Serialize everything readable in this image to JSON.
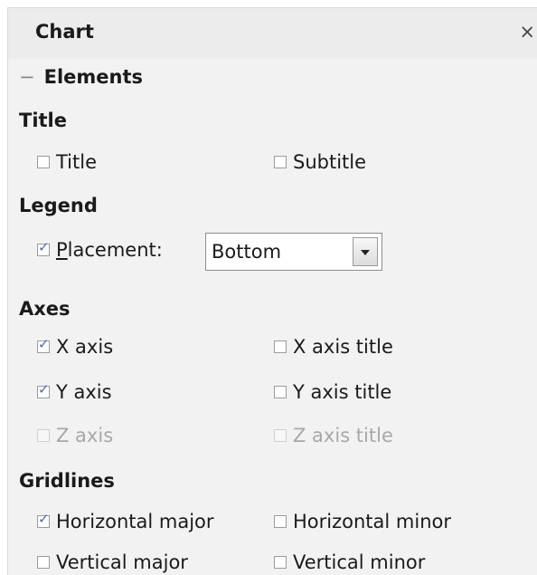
{
  "panel": {
    "title": "Chart",
    "close_glyph": "×"
  },
  "section": {
    "toggle_glyph": "−",
    "label": "Elements"
  },
  "title_group": {
    "heading": "Title",
    "title": {
      "label": "Title",
      "checked": false
    },
    "subtitle": {
      "label": "Subtitle",
      "checked": false
    }
  },
  "legend_group": {
    "heading": "Legend",
    "placement": {
      "label_first": "P",
      "label_rest": "lacement:",
      "checked": true
    },
    "placement_select": {
      "value": "Bottom"
    }
  },
  "axes_group": {
    "heading": "Axes",
    "x_axis": {
      "label": "X axis",
      "checked": true,
      "enabled": true
    },
    "x_axis_title": {
      "label": "X axis title",
      "checked": false,
      "enabled": true
    },
    "y_axis": {
      "label": "Y axis",
      "checked": true,
      "enabled": true
    },
    "y_axis_title": {
      "label": "Y axis title",
      "checked": false,
      "enabled": true
    },
    "z_axis": {
      "label": "Z axis",
      "checked": false,
      "enabled": false
    },
    "z_axis_title": {
      "label": "Z axis title",
      "checked": false,
      "enabled": false
    }
  },
  "gridlines_group": {
    "heading": "Gridlines",
    "horizontal_major": {
      "label": "Horizontal major",
      "checked": true
    },
    "horizontal_minor": {
      "label": "Horizontal minor",
      "checked": false
    },
    "vertical_major": {
      "label": "Vertical major",
      "checked": false
    },
    "vertical_minor": {
      "label": "Vertical minor",
      "checked": false
    }
  },
  "colors": {
    "check": "#4a66c2",
    "disabled_text": "#a8a8a8",
    "panel_bg": "#f2f2f2"
  }
}
